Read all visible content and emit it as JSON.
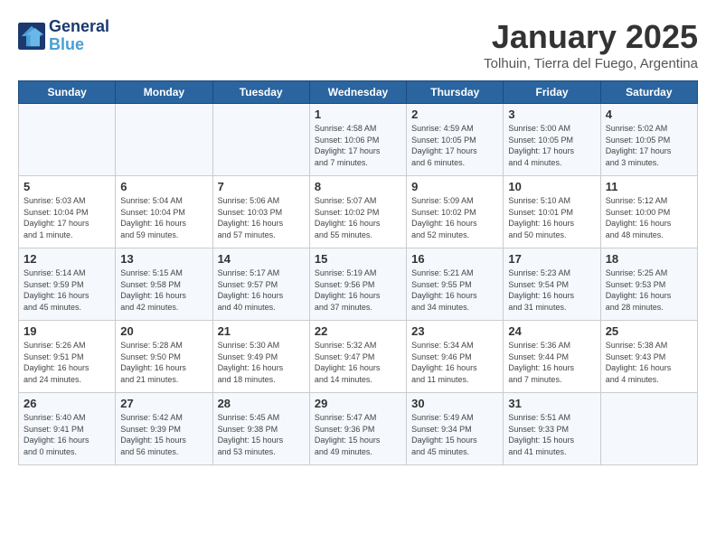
{
  "header": {
    "logo_line1": "General",
    "logo_line2": "Blue",
    "title": "January 2025",
    "subtitle": "Tolhuin, Tierra del Fuego, Argentina"
  },
  "days_of_week": [
    "Sunday",
    "Monday",
    "Tuesday",
    "Wednesday",
    "Thursday",
    "Friday",
    "Saturday"
  ],
  "weeks": [
    [
      {
        "date": "",
        "text": ""
      },
      {
        "date": "",
        "text": ""
      },
      {
        "date": "",
        "text": ""
      },
      {
        "date": "1",
        "text": "Sunrise: 4:58 AM\nSunset: 10:06 PM\nDaylight: 17 hours\nand 7 minutes."
      },
      {
        "date": "2",
        "text": "Sunrise: 4:59 AM\nSunset: 10:05 PM\nDaylight: 17 hours\nand 6 minutes."
      },
      {
        "date": "3",
        "text": "Sunrise: 5:00 AM\nSunset: 10:05 PM\nDaylight: 17 hours\nand 4 minutes."
      },
      {
        "date": "4",
        "text": "Sunrise: 5:02 AM\nSunset: 10:05 PM\nDaylight: 17 hours\nand 3 minutes."
      }
    ],
    [
      {
        "date": "5",
        "text": "Sunrise: 5:03 AM\nSunset: 10:04 PM\nDaylight: 17 hours\nand 1 minute."
      },
      {
        "date": "6",
        "text": "Sunrise: 5:04 AM\nSunset: 10:04 PM\nDaylight: 16 hours\nand 59 minutes."
      },
      {
        "date": "7",
        "text": "Sunrise: 5:06 AM\nSunset: 10:03 PM\nDaylight: 16 hours\nand 57 minutes."
      },
      {
        "date": "8",
        "text": "Sunrise: 5:07 AM\nSunset: 10:02 PM\nDaylight: 16 hours\nand 55 minutes."
      },
      {
        "date": "9",
        "text": "Sunrise: 5:09 AM\nSunset: 10:02 PM\nDaylight: 16 hours\nand 52 minutes."
      },
      {
        "date": "10",
        "text": "Sunrise: 5:10 AM\nSunset: 10:01 PM\nDaylight: 16 hours\nand 50 minutes."
      },
      {
        "date": "11",
        "text": "Sunrise: 5:12 AM\nSunset: 10:00 PM\nDaylight: 16 hours\nand 48 minutes."
      }
    ],
    [
      {
        "date": "12",
        "text": "Sunrise: 5:14 AM\nSunset: 9:59 PM\nDaylight: 16 hours\nand 45 minutes."
      },
      {
        "date": "13",
        "text": "Sunrise: 5:15 AM\nSunset: 9:58 PM\nDaylight: 16 hours\nand 42 minutes."
      },
      {
        "date": "14",
        "text": "Sunrise: 5:17 AM\nSunset: 9:57 PM\nDaylight: 16 hours\nand 40 minutes."
      },
      {
        "date": "15",
        "text": "Sunrise: 5:19 AM\nSunset: 9:56 PM\nDaylight: 16 hours\nand 37 minutes."
      },
      {
        "date": "16",
        "text": "Sunrise: 5:21 AM\nSunset: 9:55 PM\nDaylight: 16 hours\nand 34 minutes."
      },
      {
        "date": "17",
        "text": "Sunrise: 5:23 AM\nSunset: 9:54 PM\nDaylight: 16 hours\nand 31 minutes."
      },
      {
        "date": "18",
        "text": "Sunrise: 5:25 AM\nSunset: 9:53 PM\nDaylight: 16 hours\nand 28 minutes."
      }
    ],
    [
      {
        "date": "19",
        "text": "Sunrise: 5:26 AM\nSunset: 9:51 PM\nDaylight: 16 hours\nand 24 minutes."
      },
      {
        "date": "20",
        "text": "Sunrise: 5:28 AM\nSunset: 9:50 PM\nDaylight: 16 hours\nand 21 minutes."
      },
      {
        "date": "21",
        "text": "Sunrise: 5:30 AM\nSunset: 9:49 PM\nDaylight: 16 hours\nand 18 minutes."
      },
      {
        "date": "22",
        "text": "Sunrise: 5:32 AM\nSunset: 9:47 PM\nDaylight: 16 hours\nand 14 minutes."
      },
      {
        "date": "23",
        "text": "Sunrise: 5:34 AM\nSunset: 9:46 PM\nDaylight: 16 hours\nand 11 minutes."
      },
      {
        "date": "24",
        "text": "Sunrise: 5:36 AM\nSunset: 9:44 PM\nDaylight: 16 hours\nand 7 minutes."
      },
      {
        "date": "25",
        "text": "Sunrise: 5:38 AM\nSunset: 9:43 PM\nDaylight: 16 hours\nand 4 minutes."
      }
    ],
    [
      {
        "date": "26",
        "text": "Sunrise: 5:40 AM\nSunset: 9:41 PM\nDaylight: 16 hours\nand 0 minutes."
      },
      {
        "date": "27",
        "text": "Sunrise: 5:42 AM\nSunset: 9:39 PM\nDaylight: 15 hours\nand 56 minutes."
      },
      {
        "date": "28",
        "text": "Sunrise: 5:45 AM\nSunset: 9:38 PM\nDaylight: 15 hours\nand 53 minutes."
      },
      {
        "date": "29",
        "text": "Sunrise: 5:47 AM\nSunset: 9:36 PM\nDaylight: 15 hours\nand 49 minutes."
      },
      {
        "date": "30",
        "text": "Sunrise: 5:49 AM\nSunset: 9:34 PM\nDaylight: 15 hours\nand 45 minutes."
      },
      {
        "date": "31",
        "text": "Sunrise: 5:51 AM\nSunset: 9:33 PM\nDaylight: 15 hours\nand 41 minutes."
      },
      {
        "date": "",
        "text": ""
      }
    ]
  ]
}
